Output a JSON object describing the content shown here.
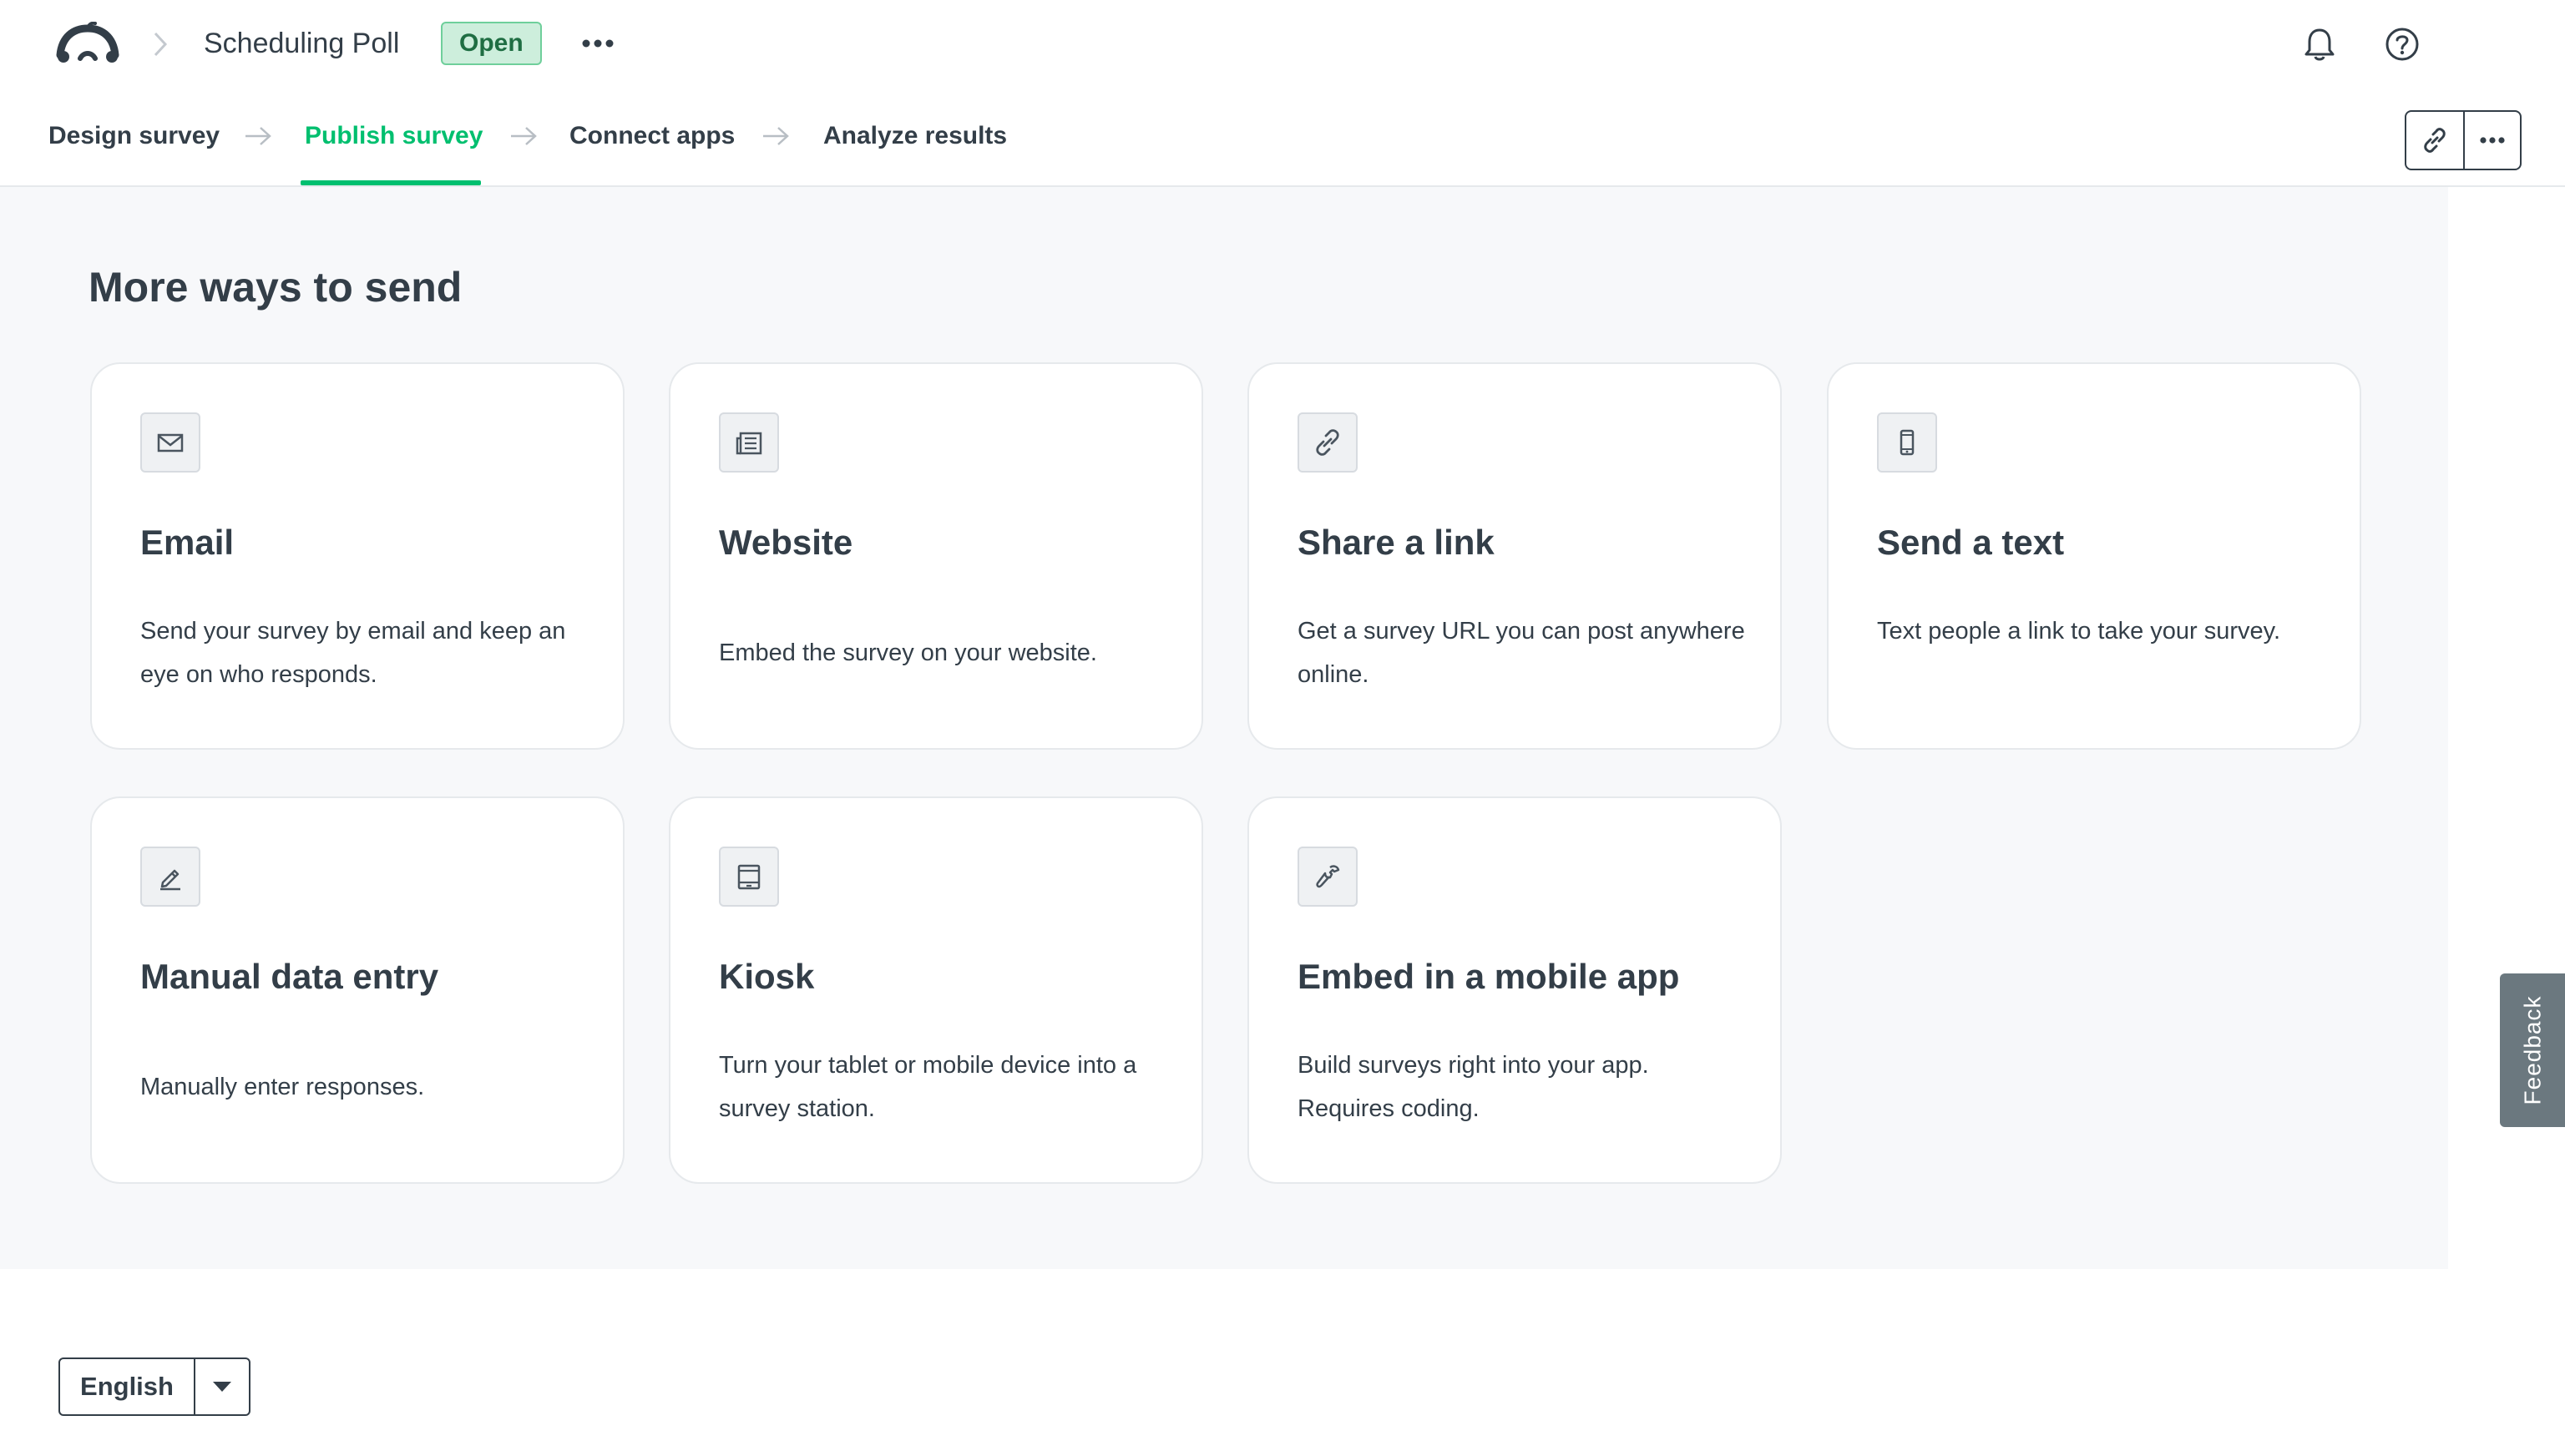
{
  "header": {
    "survey_title": "Scheduling Poll",
    "status_badge": "Open"
  },
  "steps": [
    {
      "label": "Design survey",
      "active": false
    },
    {
      "label": "Publish survey",
      "active": true
    },
    {
      "label": "Connect apps",
      "active": false
    },
    {
      "label": "Analyze results",
      "active": false
    }
  ],
  "main": {
    "section_title": "More ways to send",
    "cards": [
      {
        "icon": "email-icon",
        "title": "Email",
        "description": "Send your survey by email and keep an eye on who responds."
      },
      {
        "icon": "website-icon",
        "title": "Website",
        "description": "Embed the survey on your website."
      },
      {
        "icon": "link-icon",
        "title": "Share a link",
        "description": "Get a survey URL you can post anywhere online."
      },
      {
        "icon": "mobile-phone-icon",
        "title": "Send a text",
        "description": "Text people a link to take your survey."
      },
      {
        "icon": "pencil-icon",
        "title": "Manual data entry",
        "description": "Manually enter responses."
      },
      {
        "icon": "tablet-icon",
        "title": "Kiosk",
        "description": "Turn your tablet or mobile device into a survey station."
      },
      {
        "icon": "wrench-icon",
        "title": "Embed in a mobile app",
        "description": "Build surveys right into your app. Requires coding."
      }
    ]
  },
  "feedback_tab": "Feedback",
  "language_select": {
    "selected": "English"
  },
  "colors": {
    "accent": "#00bf6f",
    "badge_bg": "#cdeedc",
    "text": "#333e48",
    "page_bg": "#f7f8fa"
  }
}
